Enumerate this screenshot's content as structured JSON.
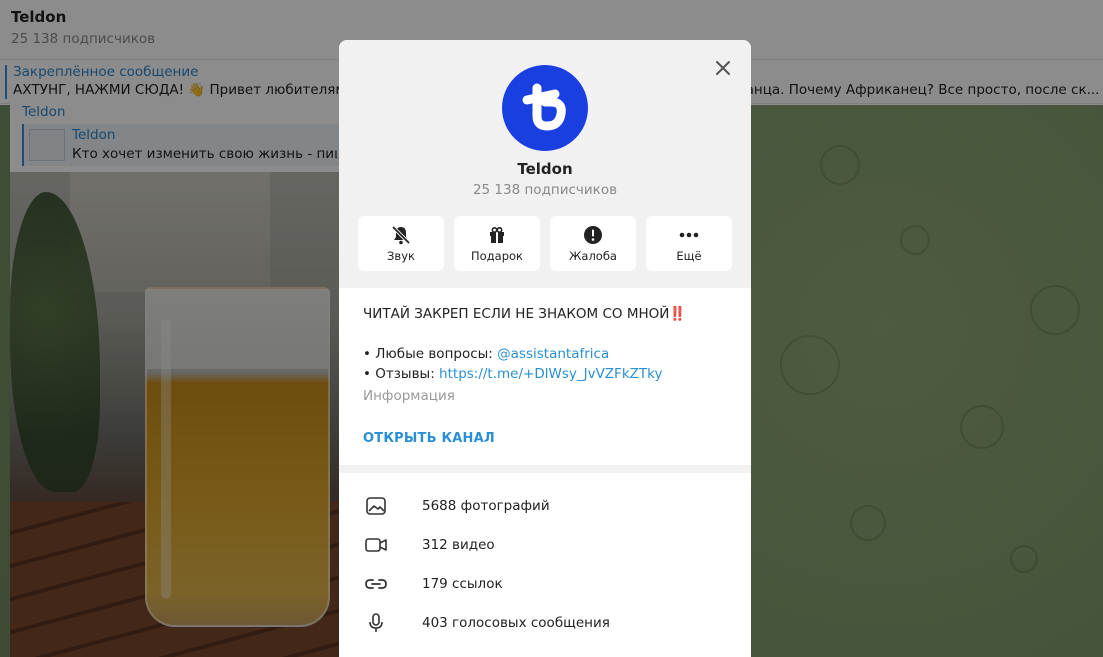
{
  "chat": {
    "title": "Teldon",
    "subscribers": "25 138 подписчиков",
    "pinned": {
      "title": "Закреплённое сообщение",
      "text": "АХТУНГ, НАЖМИ СЮДА! 👋 Привет любителям",
      "text_tail": "анца.  Почему Африканец? Все просто, после ск..."
    },
    "post": {
      "author": "Teldon",
      "forward_name": "Teldon",
      "forward_text": "Кто хочет изменить свою жизнь - пиш"
    }
  },
  "modal": {
    "title": "Teldon",
    "subscribers": "25 138 подписчиков",
    "actions": [
      {
        "label": "Звук",
        "icon": "bell-muted-icon"
      },
      {
        "label": "Подарок",
        "icon": "gift-icon"
      },
      {
        "label": "Жалоба",
        "icon": "report-icon"
      },
      {
        "label": "Ещё",
        "icon": "more-icon"
      }
    ],
    "description": {
      "headline": "ЧИТАЙ ЗАКРЕП ЕСЛИ НЕ ЗНАКОМ СО МНОЙ‼️",
      "questions_prefix": "• Любые вопросы: ",
      "questions_link": "@assistantafrica",
      "reviews_prefix": "• Отзывы: ",
      "reviews_link": "https://t.me/+DlWsy_JvVZFkZTky",
      "info_label": "Информация"
    },
    "open_channel": "ОТКРЫТЬ КАНАЛ",
    "media": [
      {
        "label": "5688 фотографий",
        "icon": "photo-icon"
      },
      {
        "label": "312 видео",
        "icon": "video-icon"
      },
      {
        "label": "179 ссылок",
        "icon": "link-icon"
      },
      {
        "label": "403 голосовых сообщения",
        "icon": "microphone-icon"
      }
    ],
    "colors": {
      "accent": "#2a8fd6",
      "avatar": "#1a3fe0"
    }
  }
}
